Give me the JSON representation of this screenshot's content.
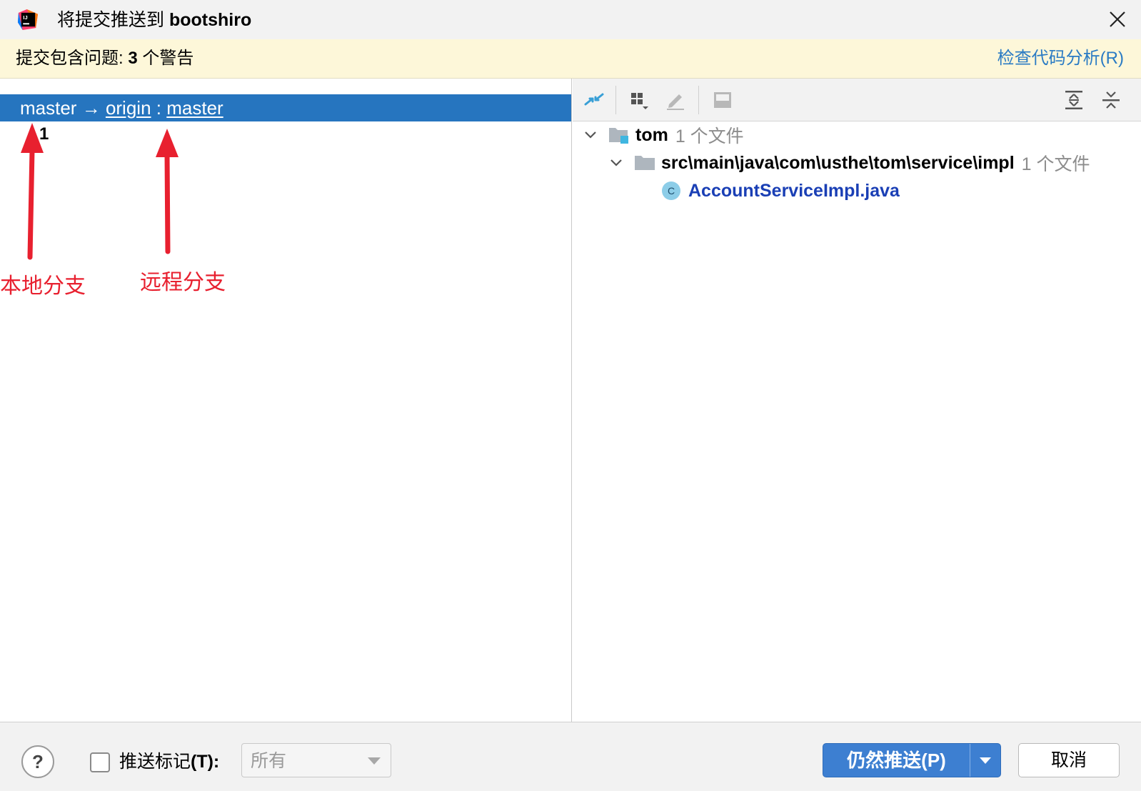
{
  "window": {
    "title_prefix": "将提交推送到 ",
    "title_repo": "bootshiro",
    "icon": "intellij-idea-icon",
    "close_icon": "close-icon"
  },
  "warning": {
    "text_prefix": "提交包含问题:",
    "count": " 3",
    "text_suffix": " 个警告",
    "link": "检查代码分析(R)",
    "bg_color": "#fdf7d9",
    "link_color": "#2a7bc4"
  },
  "branch": {
    "local": "master",
    "arrow": "→",
    "remote_name": "origin",
    "separator": ":",
    "remote_branch": "master",
    "commit_count": "1",
    "highlight_color": "#2675bf"
  },
  "annotations": {
    "local_label": "本地分支",
    "remote_label": "远程分支",
    "color": "#e8202f"
  },
  "toolbar": {
    "icons": [
      "show-diff-icon",
      "group-by-icon",
      "edit-source-icon",
      "preview-icon",
      "expand-all-icon",
      "collapse-all-icon"
    ]
  },
  "tree": {
    "root": {
      "name": "tom",
      "meta": "1 个文件"
    },
    "folder": {
      "name": "src\\main\\java\\com\\usthe\\tom\\service\\impl",
      "meta": "1 个文件"
    },
    "file": {
      "name": "AccountServiceImpl.java",
      "badge": "C"
    }
  },
  "footer": {
    "help": "?",
    "push_tags_label": "推送标记",
    "push_tags_shortcut": "(T):",
    "tags_select_value": "所有",
    "push_button": "仍然推送(P)",
    "cancel_button": "取消",
    "primary_color": "#3d7fd1"
  }
}
